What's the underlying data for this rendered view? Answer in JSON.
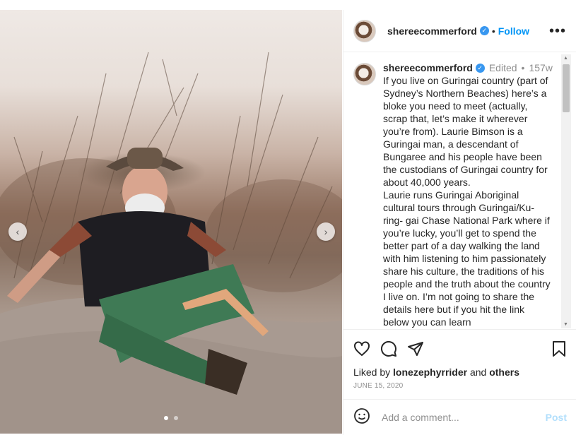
{
  "post": {
    "username": "shereecommerford",
    "follow_label": "Follow",
    "more_label": "•••",
    "separator": "•",
    "edited_label": "Edited",
    "meta_separator": "•",
    "age": "157w",
    "caption": "If you live on Guringai country (part of Sydney’s Northern Beaches) here’s a bloke you need to meet (actually, scrap that, let’s make it wherever you’re from). Laurie Bimson is a Guringai man, a descendant of Bungaree and his people have been the custodians of Guringai country for about 40,000 years.\nLaurie runs Guringai Aboriginal cultural tours through Guringai/Ku-ring- gai Chase National Park where if you’re lucky, you’ll get to spend the better part of a day walking the land with him listening to him passionately share his culture, the traditions of his people and the truth about the country I live on. I’m not going to share the details here but if you hit the link below you can learn",
    "likes_prefix": "Liked by",
    "liked_by_user": "lonezephyrrider",
    "likes_and": "and",
    "likes_others": "others",
    "date": "JUNE 15, 2020"
  },
  "comment": {
    "placeholder": "Add a comment...",
    "post_label": "Post"
  },
  "carousel": {
    "prev_label": "‹",
    "next_label": "›",
    "slide_count": 2,
    "active_slide": 1
  },
  "colors": {
    "accent": "#0095f6",
    "verified": "#3897f0",
    "post_disabled": "#b2dffc",
    "muted": "#8e8e8e"
  }
}
